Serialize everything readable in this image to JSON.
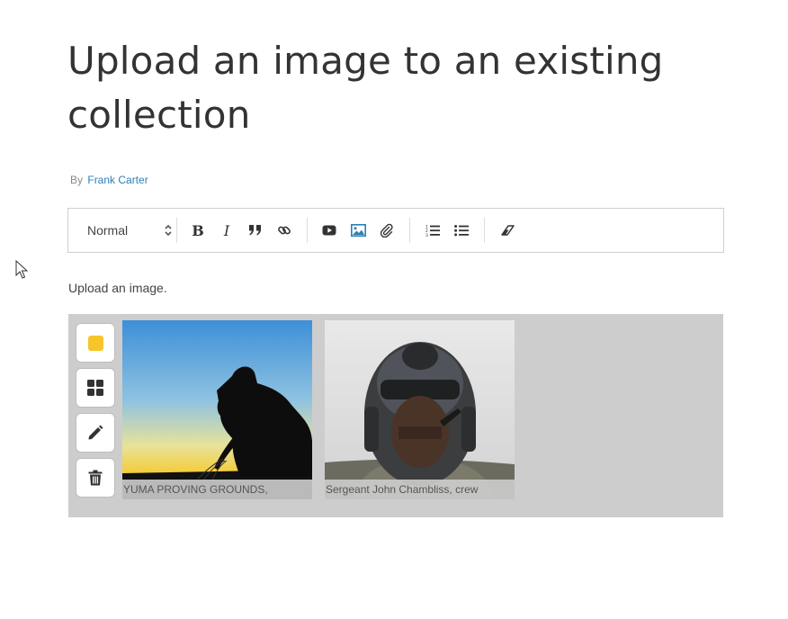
{
  "page": {
    "title": "Upload an image to an existing collection",
    "byline_prefix": "By",
    "author": "Frank Carter"
  },
  "toolbar": {
    "format_select": "Normal",
    "buttons": [
      "bold-icon",
      "italic-icon",
      "quote-icon",
      "link-icon",
      "video-icon",
      "image-icon",
      "attachment-icon",
      "ordered-list-icon",
      "bulleted-list-icon",
      "clear-format-icon"
    ]
  },
  "editor": {
    "paragraph": "Upload an image."
  },
  "gallery": {
    "swatch_color": "#f7c52b",
    "side_tools": [
      "color-swatch",
      "layout-grid-icon",
      "edit-pencil-icon",
      "delete-trash-icon"
    ],
    "images": [
      {
        "caption": "YUMA PROVING GROUNDS,"
      },
      {
        "caption": "Sergeant John Chambliss, crew"
      }
    ]
  },
  "colors": {
    "link": "#2d7fb5",
    "gallery_bg": "#cdcdcd",
    "image_button_active": "#2d7fb5"
  }
}
